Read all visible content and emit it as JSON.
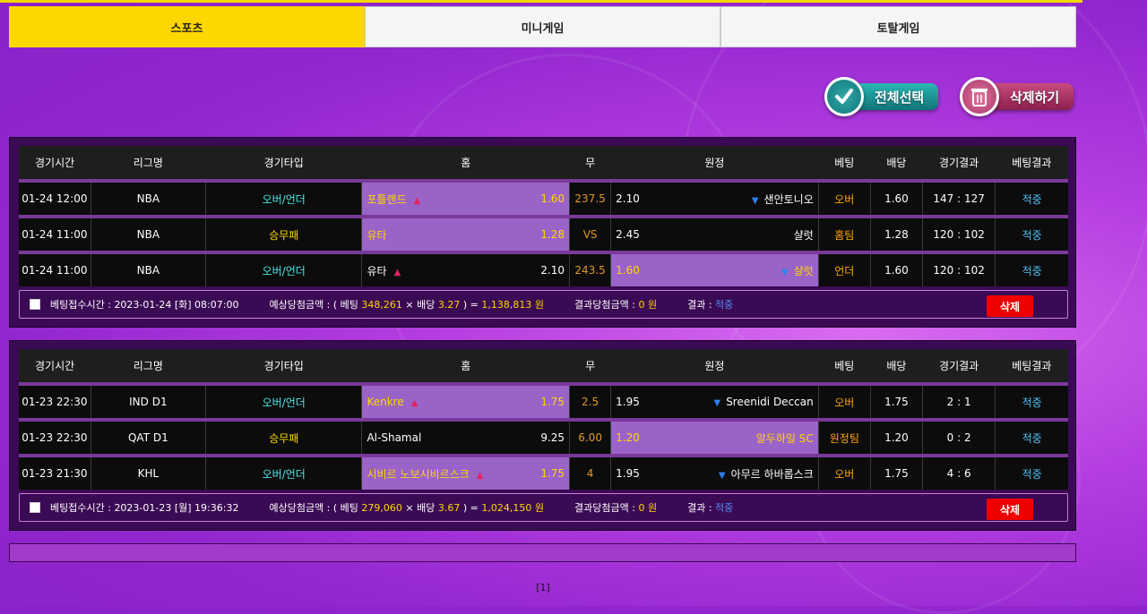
{
  "tabs": [
    {
      "label": "스포츠",
      "active": true
    },
    {
      "label": "미니게임",
      "active": false
    },
    {
      "label": "토탈게임",
      "active": false
    }
  ],
  "actions": {
    "select_all": "전체선택",
    "delete": "삭제하기",
    "select_all_icon": "checkmark-icon",
    "delete_icon": "trash-icon"
  },
  "columns": [
    "경기시간",
    "리그명",
    "경기타입",
    "홈",
    "무",
    "원정",
    "베팅",
    "배당",
    "경기결과",
    "베팅결과"
  ],
  "bets": [
    {
      "rows": [
        {
          "time": "01-24 12:00",
          "league": "NBA",
          "type": "오버/언더",
          "home": "포틀랜드",
          "home_arrow": "up",
          "home_odd": "1.60",
          "mid": "237.5",
          "away_odd": "2.10",
          "away": "샌안토니오",
          "away_arrow": "down",
          "pick": "오버",
          "odd": "1.60",
          "score": "147 : 127",
          "result": "적중",
          "selected": "home"
        },
        {
          "time": "01-24 11:00",
          "league": "NBA",
          "type": "승무패",
          "home": "유타",
          "home_arrow": "",
          "home_odd": "1.28",
          "mid": "VS",
          "away_odd": "2.45",
          "away": "샬럿",
          "away_arrow": "",
          "pick": "홈팀",
          "odd": "1.28",
          "score": "120 : 102",
          "result": "적중",
          "selected": "home"
        },
        {
          "time": "01-24 11:00",
          "league": "NBA",
          "type": "오버/언더",
          "home": "유타",
          "home_arrow": "up",
          "home_odd": "2.10",
          "mid": "243.5",
          "away_odd": "1.60",
          "away": "샬럿",
          "away_arrow": "down",
          "pick": "언더",
          "odd": "1.60",
          "score": "120 : 102",
          "result": "적중",
          "selected": "away"
        }
      ],
      "summary": {
        "time_label": "베팅접수시간 :",
        "time": "2023-01-24 [화] 08:07:00",
        "expected_label": "예상당첨금액 : ( 베팅",
        "stake": "348,261",
        "times": "× 배당",
        "total_odd": "3.27",
        "close": ") =",
        "expected": "1,138,813 원",
        "win_label": "결과당첨금액 :",
        "win": "0 원",
        "result_label": "결과 :",
        "result": "적중",
        "delete": "삭제"
      }
    },
    {
      "rows": [
        {
          "time": "01-23 22:30",
          "league": "IND D1",
          "type": "오버/언더",
          "home": "Kenkre",
          "home_arrow": "up",
          "home_odd": "1.75",
          "mid": "2.5",
          "away_odd": "1.95",
          "away": "Sreenidi Deccan",
          "away_arrow": "down",
          "pick": "오버",
          "odd": "1.75",
          "score": "2 : 1",
          "result": "적중",
          "selected": "home"
        },
        {
          "time": "01-23 22:30",
          "league": "QAT D1",
          "type": "승무패",
          "home": "Al-Shamal",
          "home_arrow": "",
          "home_odd": "9.25",
          "mid": "6.00",
          "away_odd": "1.20",
          "away": "알두하일 SC",
          "away_arrow": "",
          "pick": "원정팀",
          "odd": "1.20",
          "score": "0 : 2",
          "result": "적중",
          "selected": "away"
        },
        {
          "time": "01-23 21:30",
          "league": "KHL",
          "type": "오버/언더",
          "home": "시비르 노보시비르스크",
          "home_arrow": "up",
          "home_odd": "1.75",
          "mid": "4",
          "away_odd": "1.95",
          "away": "아무르 하바롭스크",
          "away_arrow": "down",
          "pick": "오버",
          "odd": "1.75",
          "score": "4 : 6",
          "result": "적중",
          "selected": "home"
        }
      ],
      "summary": {
        "time_label": "베팅접수시간 :",
        "time": "2023-01-23 [월] 19:36:32",
        "expected_label": "예상당첨금액 : ( 베팅",
        "stake": "279,060",
        "times": "× 배당",
        "total_odd": "3.67",
        "close": ") =",
        "expected": "1,024,150 원",
        "win_label": "결과당첨금액 :",
        "win": "0 원",
        "result_label": "결과 :",
        "result": "적중",
        "delete": "삭제"
      }
    }
  ],
  "pagination": "[1]"
}
